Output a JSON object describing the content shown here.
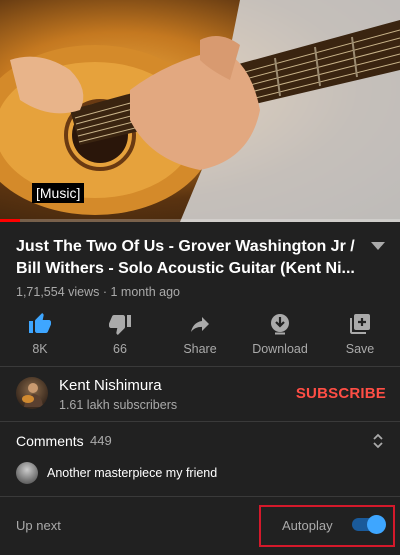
{
  "player": {
    "caption": "[Music]",
    "progress_fraction": 0.05
  },
  "video": {
    "title": "Just The Two Of Us - Grover Washington Jr / Bill Withers - Solo Acoustic Guitar (Kent Ni...",
    "views": "1,71,554 views",
    "separator": "·",
    "age": "1 month ago",
    "meta": "1,71,554 views · 1 month ago"
  },
  "actions": [
    {
      "icon": "thumbs-up-icon",
      "label": "8K",
      "active": true
    },
    {
      "icon": "thumbs-down-icon",
      "label": "66",
      "active": false
    },
    {
      "icon": "share-icon",
      "label": "Share",
      "active": false
    },
    {
      "icon": "download-icon",
      "label": "Download",
      "active": false
    },
    {
      "icon": "save-icon",
      "label": "Save",
      "active": false
    }
  ],
  "channel": {
    "name": "Kent Nishimura",
    "subscribers": "1.61 lakh subscribers",
    "subscribe_label": "SUBSCRIBE"
  },
  "comments": {
    "title": "Comments",
    "count": "449",
    "top_comment": "Another masterpiece my friend"
  },
  "upnext": {
    "label": "Up next",
    "autoplay_label": "Autoplay",
    "autoplay_on": true
  },
  "colors": {
    "background": "#212121",
    "accent_blue": "#3ea6ff",
    "subscribe_red": "#ff4e45",
    "progress_red": "#ff0000"
  }
}
